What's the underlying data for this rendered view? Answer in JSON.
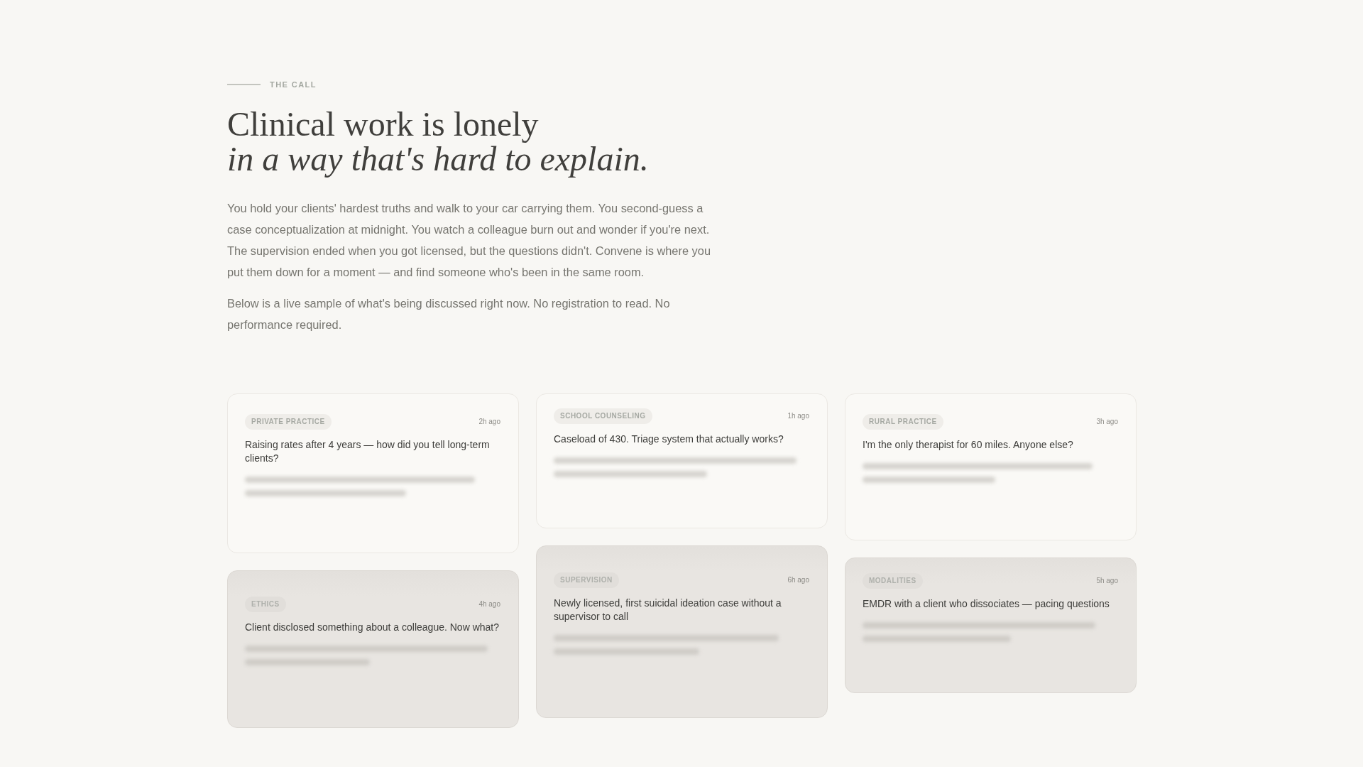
{
  "eyebrow": "THE CALL",
  "headline": [
    {
      "text": "Clinical work is lonely",
      "italic": false
    },
    {
      "text": "in a way that's hard to explain.",
      "italic": true
    }
  ],
  "intro_paragraphs": [
    "You hold your clients' hardest truths and walk to your car carrying them. You second-guess a case conceptualization at midnight. You watch a colleague burn out and wonder if you're next. The supervision ended when you got licensed, but the questions didn't. Convene is where you put them down for a moment — and find someone who's been in the same room.",
    "Below is a live sample of what's being discussed right now. No registration to read. No performance required."
  ],
  "cards": [
    {
      "tag": "PRIVATE PRACTICE",
      "time": "2h ago",
      "title": "Raising rates after 4 years — how did you tell long-term clients?",
      "faded": false
    },
    {
      "tag": "SCHOOL COUNSELING",
      "time": "1h ago",
      "title": "Caseload of 430. Triage system that actually works?",
      "faded": false
    },
    {
      "tag": "RURAL PRACTICE",
      "time": "3h ago",
      "title": "I'm the only therapist for 60 miles. Anyone else?",
      "faded": false
    },
    {
      "tag": "ETHICS",
      "time": "4h ago",
      "title": "Client disclosed something about a colleague. Now what?",
      "faded": true
    },
    {
      "tag": "SUPERVISION",
      "time": "6h ago",
      "title": "Newly licensed, first suicidal ideation case without a supervisor to call",
      "faded": true
    },
    {
      "tag": "MODALITIES",
      "time": "5h ago",
      "title": "EMDR with a client who dissociates — pacing questions",
      "faded": true
    }
  ]
}
